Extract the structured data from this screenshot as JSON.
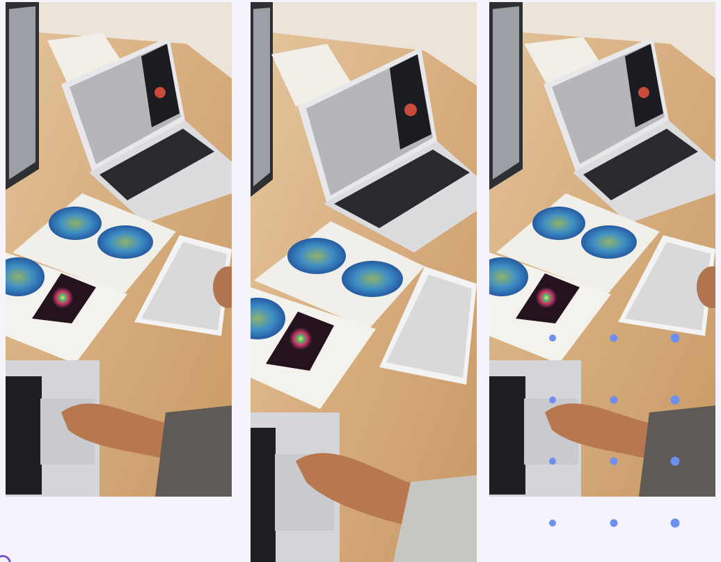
{
  "gallery": {
    "panels": [
      {
        "name": "photo-left",
        "subject": "desk-workspace-photo"
      },
      {
        "name": "photo-middle",
        "subject": "desk-workspace-photo"
      },
      {
        "name": "photo-right",
        "subject": "desk-workspace-photo"
      }
    ]
  },
  "colors": {
    "background": "#f5f3fc",
    "dot": "#6d8ff0",
    "accent": "#7a55c7",
    "wood": "#d8b083"
  }
}
